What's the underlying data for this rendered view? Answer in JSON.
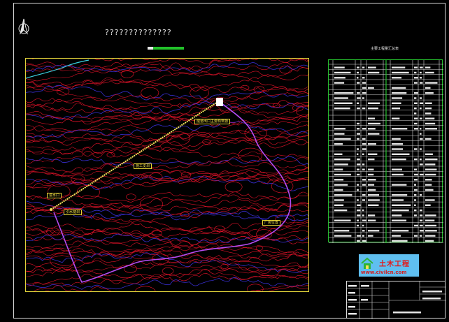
{
  "drawing": {
    "title": "??????????????",
    "table_title": "主要工程量汇总表"
  },
  "logo": {
    "name": "土木工程",
    "url": "www.civilcn.com"
  },
  "map": {
    "labels": [
      {
        "id": "label-north-end",
        "text": "隧道出口主要构筑物"
      },
      {
        "id": "label-center",
        "text": "施工支洞"
      },
      {
        "id": "label-west-upper",
        "text": "进水口"
      },
      {
        "id": "label-west-lower",
        "text": "引水隧洞"
      },
      {
        "id": "label-east",
        "text": "厂房位置"
      }
    ]
  },
  "colors": {
    "contour": "#e8132a",
    "contour_blue": "#3a2fd8",
    "river": "#b54cf2",
    "tunnel": "#f3e35a",
    "border": "#e0d23a",
    "table_border": "#26c22e"
  }
}
